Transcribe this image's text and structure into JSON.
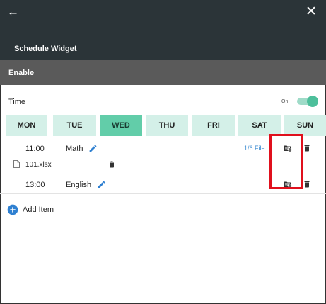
{
  "header": {
    "back_icon": "arrow-left-icon",
    "close_icon": "close-icon",
    "title": "Schedule Widget",
    "back_glyph": "←",
    "close_glyph": "✕"
  },
  "enable_bar": {
    "label": "Enable"
  },
  "time": {
    "label": "Time",
    "toggle_state_label": "On",
    "toggle_on": true
  },
  "days": [
    {
      "label": "MON",
      "active": false
    },
    {
      "label": "TUE",
      "active": false
    },
    {
      "label": "WED",
      "active": true
    },
    {
      "label": "THU",
      "active": false
    },
    {
      "label": "FRI",
      "active": false
    },
    {
      "label": "SAT",
      "active": false
    },
    {
      "label": "SUN",
      "active": false
    }
  ],
  "schedule": [
    {
      "time": "11:00",
      "subject": "Math",
      "file_count": "1/6 File",
      "file_caret": "⌄",
      "files": [
        "101.xlsx"
      ]
    },
    {
      "time": "13:00",
      "subject": "English"
    }
  ],
  "add_item": {
    "label": "Add Item"
  },
  "colors": {
    "header_bg": "#2b3438",
    "enable_bg": "#5a5a5a",
    "accent": "#62cda9",
    "day_bg": "#d4f0e8",
    "link": "#3b8bd1",
    "highlight": "#e0101d"
  }
}
